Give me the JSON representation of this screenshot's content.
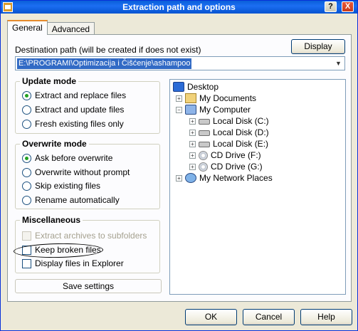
{
  "window": {
    "title": "Extraction path and options",
    "help_button": "?",
    "close_button": "X"
  },
  "tabs": [
    {
      "label": "General",
      "active": true
    },
    {
      "label": "Advanced",
      "active": false
    }
  ],
  "destination": {
    "label": "Destination path (will be created if does not exist)",
    "display_button": "Display",
    "path_value": "E:\\PROGRAMI\\Optimizacija i Čišćenje\\ashampoo"
  },
  "update_mode": {
    "title": "Update mode",
    "options": [
      {
        "label": "Extract and replace files",
        "selected": true
      },
      {
        "label": "Extract and update files",
        "selected": false
      },
      {
        "label": "Fresh existing files only",
        "selected": false
      }
    ]
  },
  "overwrite_mode": {
    "title": "Overwrite mode",
    "options": [
      {
        "label": "Ask before overwrite",
        "selected": true
      },
      {
        "label": "Overwrite without prompt",
        "selected": false
      },
      {
        "label": "Skip existing files",
        "selected": false
      },
      {
        "label": "Rename automatically",
        "selected": false
      }
    ]
  },
  "miscellaneous": {
    "title": "Miscellaneous",
    "options": [
      {
        "label": "Extract archives to subfolders",
        "checked": false,
        "disabled": true
      },
      {
        "label": "Keep broken files",
        "checked": false,
        "disabled": false
      },
      {
        "label": "Display files in Explorer",
        "checked": false,
        "disabled": false
      }
    ]
  },
  "save_settings": "Save settings",
  "tree": {
    "nodes": [
      {
        "label": "Desktop",
        "icon": "desktop-icon",
        "expander": ""
      },
      {
        "label": "My Documents",
        "icon": "my-documents-icon",
        "expander": "+"
      },
      {
        "label": "My Computer",
        "icon": "my-computer-icon",
        "expander": "−"
      },
      {
        "label": "Local Disk (C:)",
        "icon": "hard-disk-icon",
        "expander": "+"
      },
      {
        "label": "Local Disk (D:)",
        "icon": "hard-disk-icon",
        "expander": "+"
      },
      {
        "label": "Local Disk (E:)",
        "icon": "hard-disk-icon",
        "expander": "+"
      },
      {
        "label": "CD Drive (F:)",
        "icon": "cd-drive-icon",
        "expander": "+"
      },
      {
        "label": "CD Drive (G:)",
        "icon": "cd-drive-icon",
        "expander": "+"
      },
      {
        "label": "My Network Places",
        "icon": "network-places-icon",
        "expander": "+"
      }
    ]
  },
  "footer": {
    "ok": "OK",
    "cancel": "Cancel",
    "help": "Help"
  }
}
